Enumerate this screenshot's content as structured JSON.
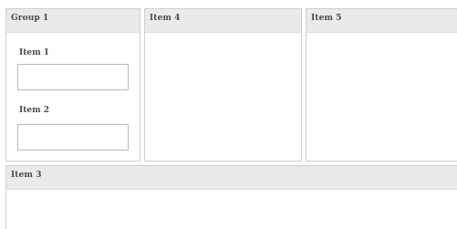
{
  "group1": {
    "title": "Group 1",
    "fields": [
      {
        "label": "Item 1",
        "value": "",
        "placeholder": ""
      },
      {
        "label": "Item 2",
        "value": "",
        "placeholder": ""
      }
    ]
  },
  "panels": {
    "item4": {
      "title": "Item 4"
    },
    "item5": {
      "title": "Item 5"
    },
    "item3": {
      "title": "Item 3"
    }
  }
}
